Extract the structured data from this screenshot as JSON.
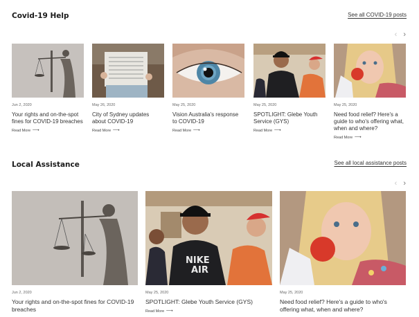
{
  "covid": {
    "title": "Covid-19 Help",
    "see_all": "See all COVID-19 posts",
    "prev_icon": "chevron-left-icon",
    "next_icon": "chevron-right-icon",
    "cards": [
      {
        "date": "Jun 2, 2020",
        "title": "Your rights and on-the-spot fines for COVID-19 breaches",
        "more": "Read More",
        "image": "lady-justice-statue"
      },
      {
        "date": "May 26, 2020",
        "title": "City of Sydney updates about COVID-19",
        "more": "Read More",
        "image": "person-reading-newspaper"
      },
      {
        "date": "May 25, 2020",
        "title": "Vision Australia's response to COVID-19",
        "more": "Read More",
        "image": "blue-eye-closeup"
      },
      {
        "date": "May 25, 2020",
        "title": "SPOTLIGHT: Glebe Youth Service (GYS)",
        "more": "Read More",
        "image": "young-men-group"
      },
      {
        "date": "May 25, 2020",
        "title": "Need food relief? Here's a guide to who's offering what, when and where?",
        "more": "Read More",
        "image": "girl-eating-apple"
      }
    ]
  },
  "local": {
    "title": "Local Assistance",
    "see_all": "See all local assistance posts",
    "cards": [
      {
        "date": "Jun 2, 2020",
        "title": "Your rights and on-the-spot fines for COVID-19 breaches",
        "image": "lady-justice-statue"
      },
      {
        "date": "May 25, 2020",
        "title": "SPOTLIGHT: Glebe Youth Service (GYS)",
        "more": "Read More",
        "image": "young-men-group"
      },
      {
        "date": "May 25, 2020",
        "title": "Need food relief? Here's a guide to who's offering what, when and where?",
        "image": "girl-eating-apple"
      }
    ]
  },
  "arrow_glyph": "⟶",
  "prev_glyph": "‹",
  "next_glyph": "›"
}
